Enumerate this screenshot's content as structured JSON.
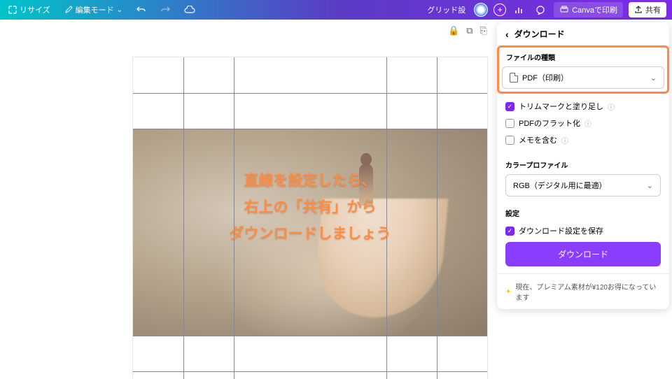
{
  "topbar": {
    "resize": "リサイズ",
    "edit_mode": "編集モード",
    "grid": "グリッド設",
    "print": "Canvaで印刷",
    "share": "共有"
  },
  "overlay": {
    "line1": "直線を設定したら、",
    "line2": "右上の「共有」から",
    "line3": "ダウンロードしましょう"
  },
  "panel": {
    "title": "ダウンロード",
    "file_type_label": "ファイルの種類",
    "file_type_value": "PDF（印刷）",
    "trim_marks": "トリムマークと塗り足し",
    "flatten_pdf": "PDFのフラット化",
    "include_notes": "メモを含む",
    "color_profile_label": "カラープロファイル",
    "color_profile_value": "RGB（デジタル用に最適）",
    "settings_label": "設定",
    "save_settings": "ダウンロード設定を保存",
    "download_button": "ダウンロード",
    "premium_note": "現在、プレミアム素材が¥120お得になっています"
  }
}
